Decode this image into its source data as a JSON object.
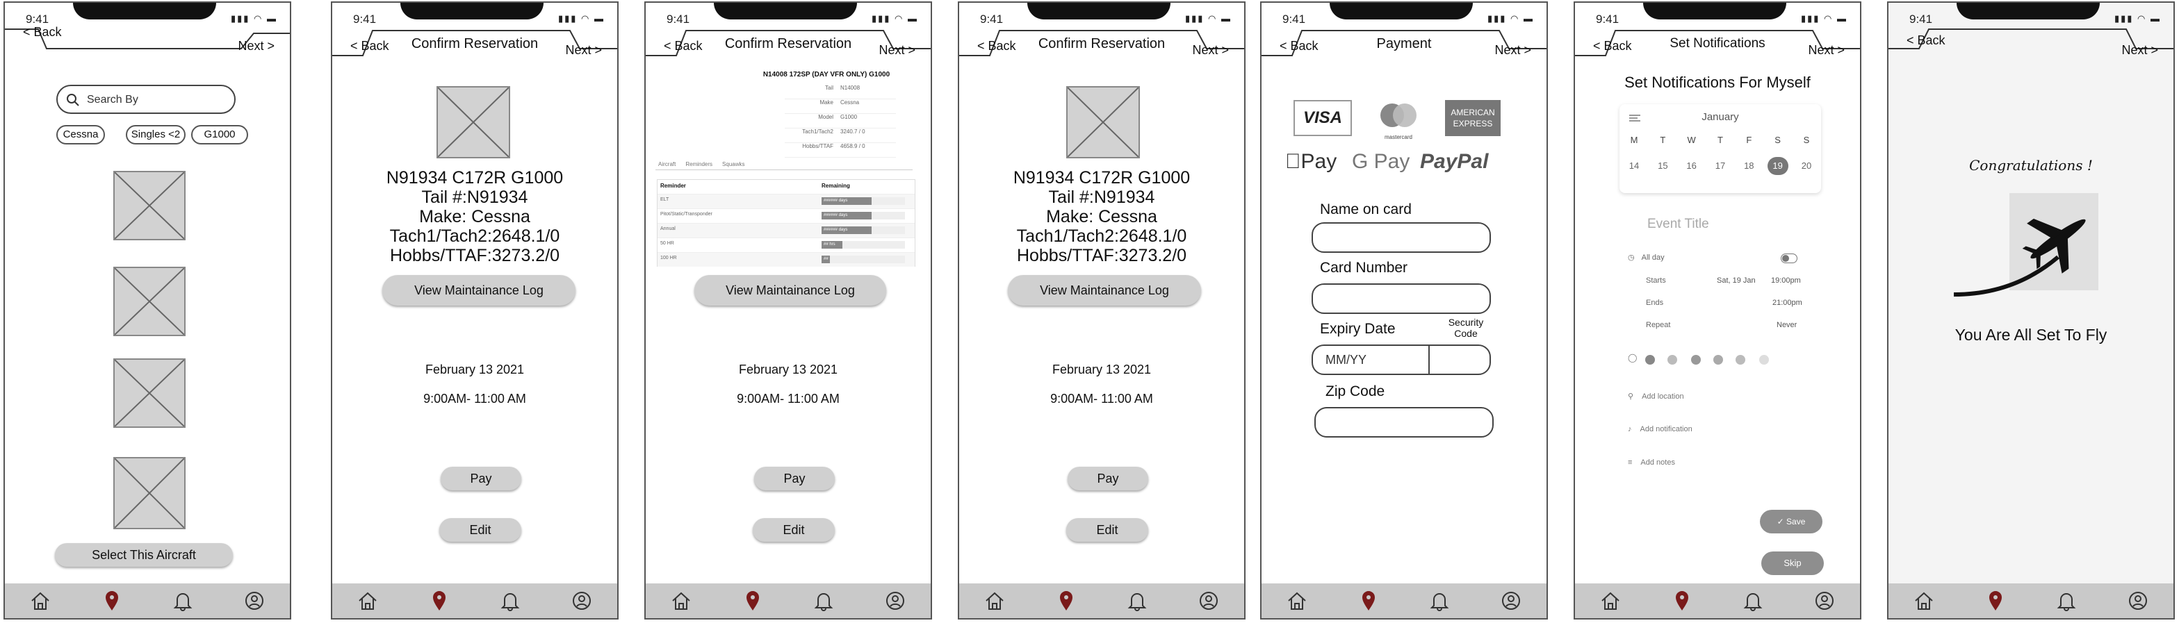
{
  "status": {
    "time": "9:41",
    "icons": "▮▮▮ ◠ ▬"
  },
  "nav": {
    "back": "< Back",
    "next": "Next >"
  },
  "tabs": [
    {
      "name": "home-icon"
    },
    {
      "name": "location-pin-icon"
    },
    {
      "name": "bell-icon"
    },
    {
      "name": "profile-icon"
    }
  ],
  "colors": {
    "accent": "#7a1a1a",
    "tabbar": "#c9c9c9",
    "button": "#d0d0d0"
  },
  "screen1": {
    "search_placeholder": "Search By",
    "filters": [
      "Cessna",
      "Singles <2",
      "G1000"
    ],
    "select_button": "Select  This Aircraft"
  },
  "screen2": {
    "title": "Confirm Reservation",
    "aircraft_lines": [
      "N91934 C172R G1000",
      "Tail #:N91934",
      "Make: Cessna",
      "Tach1/Tach2:2648.1/0",
      "Hobbs/TTAF:3273.2/0"
    ],
    "log_button": "View Maintainance Log",
    "date": "February 13 2021",
    "time_range": "9:00AM- 11:00 AM",
    "pay_button": "Pay",
    "edit_button": "Edit"
  },
  "screen3": {
    "title": "Confirm Reservation",
    "log_header": "N14008 172SP (DAY VFR ONLY) G1000",
    "log_rows": [
      {
        "k": "Tail",
        "v": "N14008"
      },
      {
        "k": "Make",
        "v": "Cessna"
      },
      {
        "k": "Model",
        "v": "G1000"
      },
      {
        "k": "Tach1/Tach2",
        "v": "3240.7 / 0"
      },
      {
        "k": "Hobbs/TTAF",
        "v": "4658.9 / 0"
      }
    ],
    "log_tabs": [
      "Aircraft",
      "Reminders",
      "Squawks"
    ],
    "reminder_headers": [
      "Reminder",
      "Remaining"
    ],
    "reminders": [
      {
        "name": "ELT",
        "bar": "###### days",
        "fill": 0.6
      },
      {
        "name": "Pitot/Static/Transponder",
        "bar": "###### days",
        "fill": 0.6
      },
      {
        "name": "Annual",
        "bar": "###### days",
        "fill": 0.6
      },
      {
        "name": "50 HR",
        "bar": "## hrs",
        "fill": 0.25
      },
      {
        "name": "100 HR",
        "bar": "##",
        "fill": 0.1
      }
    ],
    "log_button": "View Maintainance Log",
    "date": "February 13 2021",
    "time_range": "9:00AM- 11:00 AM",
    "pay_button": "Pay",
    "edit_button": "Edit"
  },
  "screen4": {
    "title": "Confirm Reservation",
    "aircraft_lines": [
      "N91934 C172R G1000",
      "Tail #:N91934",
      "Make: Cessna",
      "Tach1/Tach2:2648.1/0",
      "Hobbs/TTAF:3273.2/0"
    ],
    "log_button": "View Maintainance Log",
    "date": "February 13 2021",
    "time_range": "9:00AM- 11:00 AM",
    "pay_button": "Pay",
    "edit_button": "Edit"
  },
  "screen5": {
    "title": "Payment",
    "cards": {
      "visa": "VISA",
      "mastercard": "mastercard",
      "amex_top": "AMERICAN",
      "amex_bottom": "EXPRESS"
    },
    "wallets": {
      "apple": "Pay",
      "google": "G Pay",
      "paypal": "PayPal"
    },
    "name_label": "Name on card",
    "card_label": "Card Number",
    "expiry_label": "Expiry Date",
    "security_label": "Security Code",
    "expiry_placeholder": "MM/YY",
    "zip_label": "Zip Code"
  },
  "screen6": {
    "title": "Set Notifications",
    "heading": "Set Notifications For Myself",
    "month": "January",
    "weekdays": [
      "M",
      "T",
      "W",
      "T",
      "F",
      "S",
      "S"
    ],
    "days": [
      "14",
      "15",
      "16",
      "17",
      "18",
      "19",
      "20"
    ],
    "selected_day": "19",
    "event_title_placeholder": "Event Title",
    "all_day": "All day",
    "starts_label": "Starts",
    "starts_date": "Sat, 19 Jan",
    "starts_time": "19:00pm",
    "ends_label": "Ends",
    "ends_time": "21:00pm",
    "repeat_label": "Repeat",
    "repeat_value": "Never",
    "add_location": "Add location",
    "add_notification": "Add notification",
    "add_notes": "Add notes",
    "save_button": "✓ Save",
    "skip_button": "Skip"
  },
  "screen7": {
    "congrats": "Congratulations !",
    "message": "You Are All Set To Fly"
  }
}
